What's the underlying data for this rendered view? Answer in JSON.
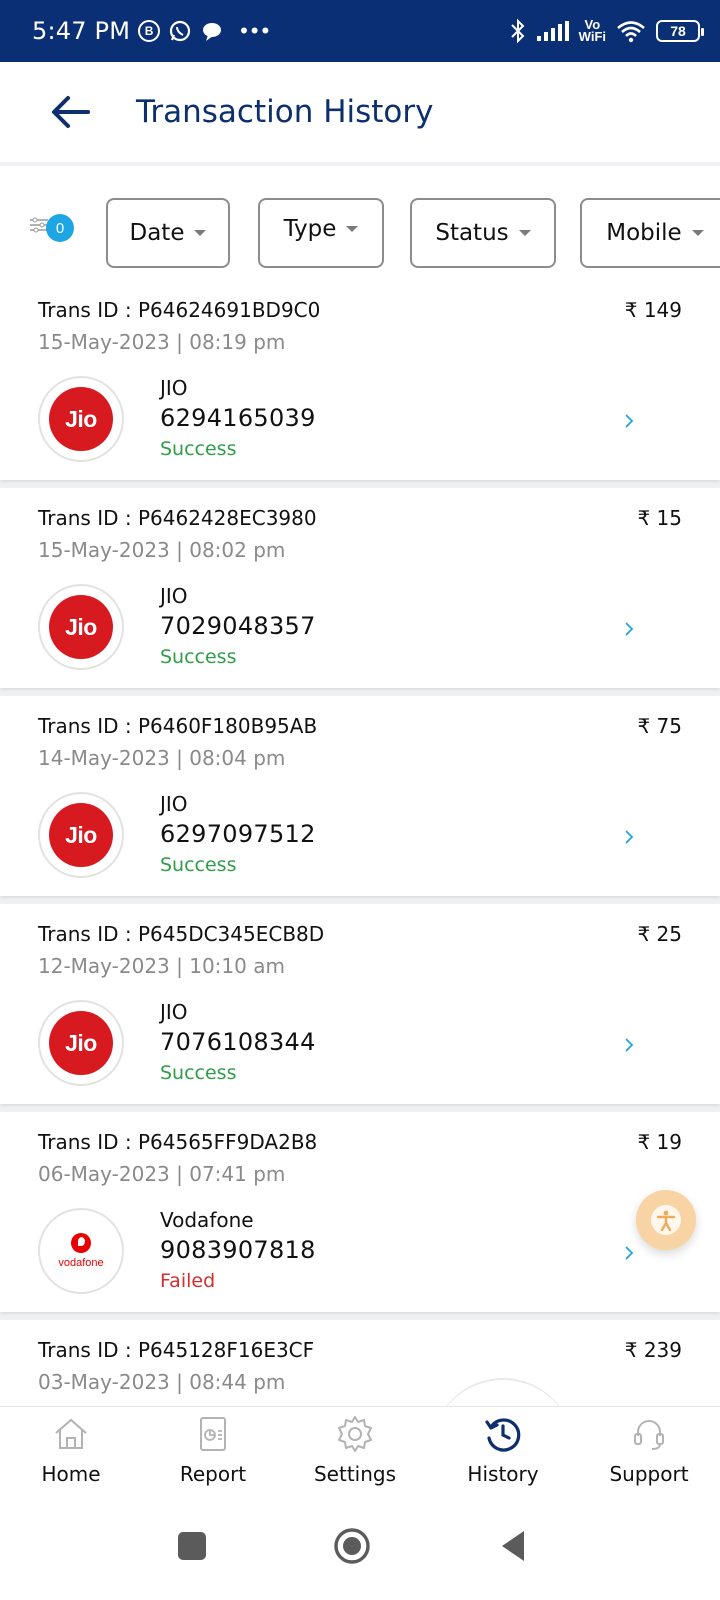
{
  "status_bar": {
    "time": "5:47 PM",
    "b_badge": "B",
    "dots": "•••",
    "vowifi_top": "Vo",
    "vowifi_bottom": "WiFi",
    "battery": "78"
  },
  "header": {
    "title": "Transaction History",
    "back_icon": "arrow-left-icon"
  },
  "filters": {
    "badge_count": "0",
    "chips": [
      "Date",
      "Type",
      "Status",
      "Mobile"
    ]
  },
  "transactions": [
    {
      "trans_id": "Trans ID : P64624691BD9C0",
      "datetime": "15-May-2023 | 08:19 pm",
      "amount": "₹ 149",
      "operator": "JIO",
      "logo_text": "Jio",
      "mobile": "6294165039",
      "status": "Success"
    },
    {
      "trans_id": "Trans ID : P6462428EC3980",
      "datetime": "15-May-2023 | 08:02 pm",
      "amount": "₹ 15",
      "operator": "JIO",
      "logo_text": "Jio",
      "mobile": "7029048357",
      "status": "Success"
    },
    {
      "trans_id": "Trans ID : P6460F180B95AB",
      "datetime": "14-May-2023 | 08:04 pm",
      "amount": "₹ 75",
      "operator": "JIO",
      "logo_text": "Jio",
      "mobile": "6297097512",
      "status": "Success"
    },
    {
      "trans_id": "Trans ID : P645DC345ECB8D",
      "datetime": "12-May-2023 | 10:10 am",
      "amount": "₹ 25",
      "operator": "JIO",
      "logo_text": "Jio",
      "mobile": "7076108344",
      "status": "Success"
    },
    {
      "trans_id": "Trans ID : P64565FF9DA2B8",
      "datetime": "06-May-2023 | 07:41 pm",
      "amount": "₹ 19",
      "operator": "Vodafone",
      "logo_text": "vodafone",
      "mobile": "9083907818",
      "status": "Failed"
    },
    {
      "trans_id": "Trans ID : P645128F16E3CF",
      "datetime": "03-May-2023 | 08:44 pm",
      "amount": "₹ 239",
      "operator": "",
      "logo_text": "",
      "mobile": "",
      "status": ""
    }
  ],
  "bottom_nav": [
    {
      "label": "Home",
      "icon": "home-icon"
    },
    {
      "label": "Report",
      "icon": "report-icon"
    },
    {
      "label": "Settings",
      "icon": "gear-icon"
    },
    {
      "label": "History",
      "icon": "history-icon",
      "active": true
    },
    {
      "label": "Support",
      "icon": "headset-icon"
    }
  ],
  "colors": {
    "status_bar": "#0b2f75",
    "title": "#0d2f6e",
    "success": "#2e9e48",
    "failed": "#d32f2f",
    "badge": "#1ea5e3",
    "jio_red": "#d71920",
    "chevron": "#1ea5e3"
  }
}
